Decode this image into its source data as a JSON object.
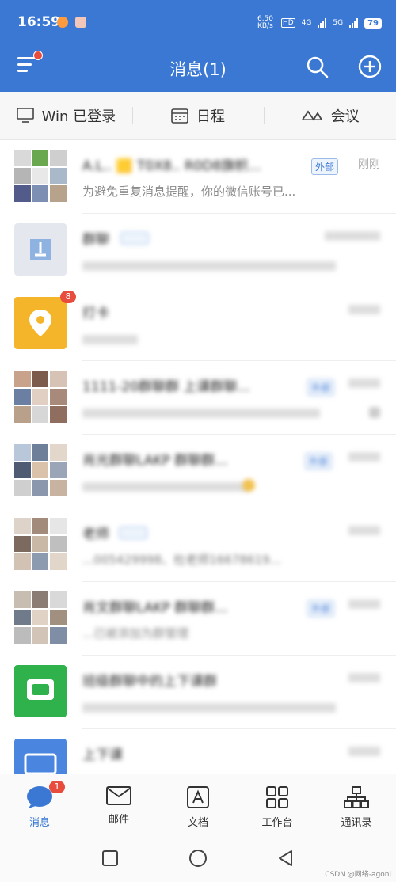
{
  "status_bar": {
    "time": "16:59",
    "net_speed": "6.50 KB/s",
    "hd1": "HD",
    "network1": "4G",
    "network2": "5G",
    "battery": "79"
  },
  "header": {
    "title": "消息(1)",
    "menu_icon": "hamburger-icon",
    "search_icon": "search-icon",
    "add_icon": "plus-circle-icon"
  },
  "quickbar": {
    "win_login": "Win 已登录",
    "schedule": "日程",
    "meeting": "会议"
  },
  "messages": [
    {
      "name": "A.L.. 🟨 T0X8.. R0D8旗帜...",
      "tag": "外部",
      "time": "刚刚",
      "preview": "为避免重复消息提醒，你的微信账号已..."
    },
    {
      "name": "群聊",
      "tag": "",
      "time": "",
      "preview": "",
      "badge": ""
    },
    {
      "name": "打卡",
      "tag": "",
      "time": "",
      "preview": "",
      "badge": "8"
    },
    {
      "name": "1111-20群聊群 上课群聊...",
      "tag": "外部",
      "time": "",
      "preview": ""
    },
    {
      "name": "肖光群聊LAKP 群聊群...",
      "tag": "外部",
      "time": "",
      "preview": ""
    },
    {
      "name": "老师",
      "tag": "",
      "time": "",
      "preview": "...005429998、杜老师16678619..."
    },
    {
      "name": "肖文群聊LAKP 群聊群...",
      "tag": "外部",
      "time": "",
      "preview": "...已被添加为群管理"
    },
    {
      "name": "班级群聊中的上下课群",
      "tag": "",
      "time": "",
      "preview": ""
    },
    {
      "name": "上下课",
      "tag": "",
      "time": "",
      "preview": ""
    }
  ],
  "bottom_nav": [
    {
      "label": "消息",
      "icon": "chat-bubble-icon",
      "badge": "1",
      "active": true
    },
    {
      "label": "邮件",
      "icon": "mail-icon",
      "active": false
    },
    {
      "label": "文档",
      "icon": "document-icon",
      "active": false
    },
    {
      "label": "工作台",
      "icon": "grid-icon",
      "active": false
    },
    {
      "label": "通讯录",
      "icon": "org-chart-icon",
      "active": false
    }
  ],
  "watermark": "CSDN @网络-agoni"
}
